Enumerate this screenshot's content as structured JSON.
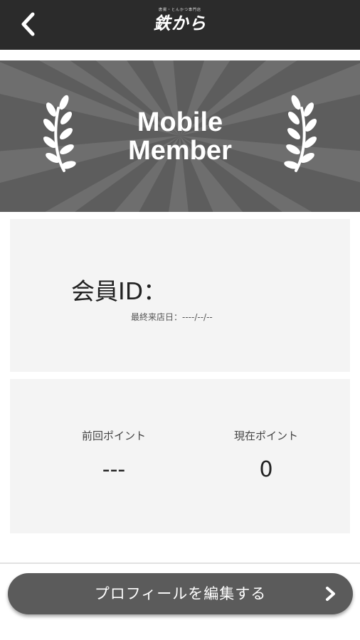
{
  "header": {
    "back_icon": "chevron-left-icon",
    "logo_small": "唐揚・とんかつ専門店",
    "logo_main": "鉄から"
  },
  "banner": {
    "title_line1": "Mobile",
    "title_line2": "Member",
    "decoration_icon": "laurel-icon"
  },
  "member": {
    "id_label": "会員ID：",
    "last_visit_label": "最終来店日：",
    "last_visit_value": "----/--/--"
  },
  "points": {
    "previous_label": "前回ポイント",
    "previous_value": "---",
    "current_label": "現在ポイント",
    "current_value": "0"
  },
  "actions": {
    "edit_profile_label": "プロフィールを編集する",
    "edit_profile_icon": "chevron-right-icon"
  },
  "colors": {
    "header_bg": "#2b2b2b",
    "banner_bg": "#5d5d5d",
    "card_bg": "#f4f4f4",
    "button_bg": "#5b5b5b"
  }
}
